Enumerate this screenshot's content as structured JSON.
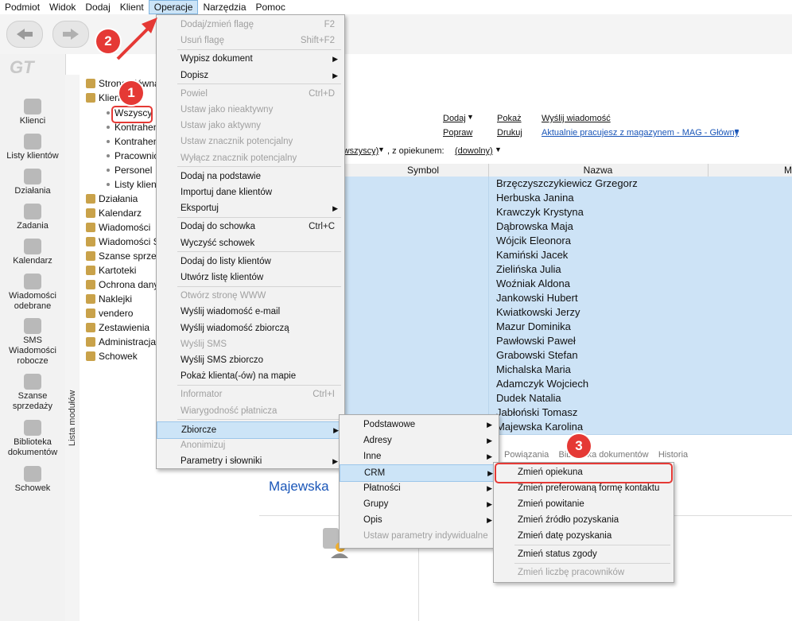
{
  "menubar": {
    "items": [
      "Podmiot",
      "Widok",
      "Dodaj",
      "Klient",
      "Operacje",
      "Narzędzia",
      "Pomoc"
    ],
    "active_index": 4
  },
  "leftbar": {
    "items": [
      "Klienci",
      "Listy klientów",
      "Działania",
      "Zadania",
      "Kalendarz",
      "Wiadomości odebrane",
      "SMS",
      "Wiadomości robocze",
      "Szanse sprzedaży",
      "Biblioteka dokumentów",
      "Schowek"
    ],
    "module_label": "Lista modułów"
  },
  "tree": {
    "items": [
      "Strona główna",
      "Klienci",
      "Wszyscy",
      "Kontrahenci",
      "Kontrahenci",
      "Pracownicy",
      "Personel",
      "Listy klientów",
      "Działania",
      "Kalendarz",
      "Wiadomości",
      "Wiadomości SMS",
      "Szanse sprzedaży",
      "Kartoteki",
      "Ochrona danych",
      "Naklejki",
      "vendero",
      "Zestawienia",
      "Administracja",
      "Schowek"
    ]
  },
  "main": {
    "links": {
      "dodaj": "Dodaj",
      "pokaz": "Pokaż",
      "wyslij": "Wyślij wiadomość",
      "popraw": "Popraw",
      "drukuj": "Drukuj",
      "magazyn": "Aktualnie pracujesz z magazynem - MAG - Główny"
    },
    "filter_prefix": "(wszyscy)",
    "filter_label": ", z opiekunem:",
    "filter_value": "(dowolny)",
    "columns": [
      "Symbol",
      "Nazwa",
      "M"
    ],
    "rows": [
      "Brzęczyszczykiewicz Grzegorz",
      "Herbuska Janina",
      "Krawczyk Krystyna",
      "Dąbrowska Maja",
      "Wójcik Eleonora",
      "Kamiński Jacek",
      "Zielińska Julia",
      "Woźniak Aldona",
      "Jankowski Hubert",
      "Kwiatkowski Jerzy",
      "Mazur Dominika",
      "Pawłowski Paweł",
      "Grabowski Stefan",
      "Michalska Maria",
      "Adamczyk Wojciech",
      "Dudek Natalia",
      "Jabłoński Tomasz",
      "Majewska Karolina"
    ],
    "detail_tabs": [
      "Powiązania",
      "Biblioteka dokumentów",
      "Historia"
    ],
    "detail_title": "Majewska"
  },
  "menu_operacje": {
    "items": [
      {
        "label": "Dodaj/zmień flagę",
        "shortcut": "F2",
        "disabled": true
      },
      {
        "label": "Usuń flagę",
        "shortcut": "Shift+F2",
        "disabled": true
      },
      {
        "label": "Wypisz dokument",
        "submenu": true
      },
      {
        "label": "Dopisz",
        "submenu": true
      },
      {
        "label": "Powiel",
        "shortcut": "Ctrl+D",
        "disabled": true
      },
      {
        "label": "Ustaw jako nieaktywny",
        "disabled": true
      },
      {
        "label": "Ustaw jako aktywny",
        "disabled": true
      },
      {
        "label": "Ustaw znacznik potencjalny",
        "disabled": true
      },
      {
        "label": "Wyłącz znacznik potencjalny",
        "disabled": true
      },
      {
        "label": "Dodaj na podstawie"
      },
      {
        "label": "Importuj dane klientów"
      },
      {
        "label": "Eksportuj",
        "submenu": true
      },
      {
        "label": "Dodaj do schowka",
        "shortcut": "Ctrl+C"
      },
      {
        "label": "Wyczyść schowek"
      },
      {
        "label": "Dodaj do listy klientów"
      },
      {
        "label": "Utwórz listę klientów"
      },
      {
        "label": "Otwórz stronę WWW",
        "disabled": true
      },
      {
        "label": "Wyślij wiadomość e-mail"
      },
      {
        "label": "Wyślij wiadomość zbiorczą"
      },
      {
        "label": "Wyślij SMS",
        "disabled": true
      },
      {
        "label": "Wyślij SMS zbiorczo"
      },
      {
        "label": "Pokaż klienta(-ów) na mapie"
      },
      {
        "label": "Informator",
        "shortcut": "Ctrl+I",
        "disabled": true
      },
      {
        "label": "Wiarygodność płatnicza",
        "disabled": true
      },
      {
        "label": "Zbiorcze",
        "submenu": true,
        "highlighted": true
      },
      {
        "label": "Anonimizuj",
        "disabled": true
      },
      {
        "label": "Parametry i słowniki",
        "submenu": true
      }
    ]
  },
  "menu_zbiorcze": {
    "items": [
      {
        "label": "Podstawowe",
        "submenu": true
      },
      {
        "label": "Adresy",
        "submenu": true
      },
      {
        "label": "Inne",
        "submenu": true
      },
      {
        "label": "CRM",
        "submenu": true,
        "highlighted": true
      },
      {
        "label": "Płatności",
        "submenu": true
      },
      {
        "label": "Grupy",
        "submenu": true
      },
      {
        "label": "Opis",
        "submenu": true
      },
      {
        "label": "Ustaw parametry indywidualne",
        "disabled": true
      }
    ]
  },
  "menu_crm": {
    "items": [
      {
        "label": "Zmień opiekuna"
      },
      {
        "label": "Zmień preferowaną formę kontaktu"
      },
      {
        "label": "Zmień powitanie"
      },
      {
        "label": "Zmień źródło pozyskania"
      },
      {
        "label": "Zmień datę pozyskania"
      },
      {
        "label": "Zmień status zgody"
      },
      {
        "label": "Zmień liczbę pracowników",
        "disabled": true
      }
    ]
  },
  "callouts": [
    "1",
    "2",
    "3"
  ],
  "colors": {
    "accent_red": "#e53935",
    "selection_blue": "#cde3f6",
    "menu_highlight": "#cce4f7",
    "link_blue": "#1a56b8"
  }
}
